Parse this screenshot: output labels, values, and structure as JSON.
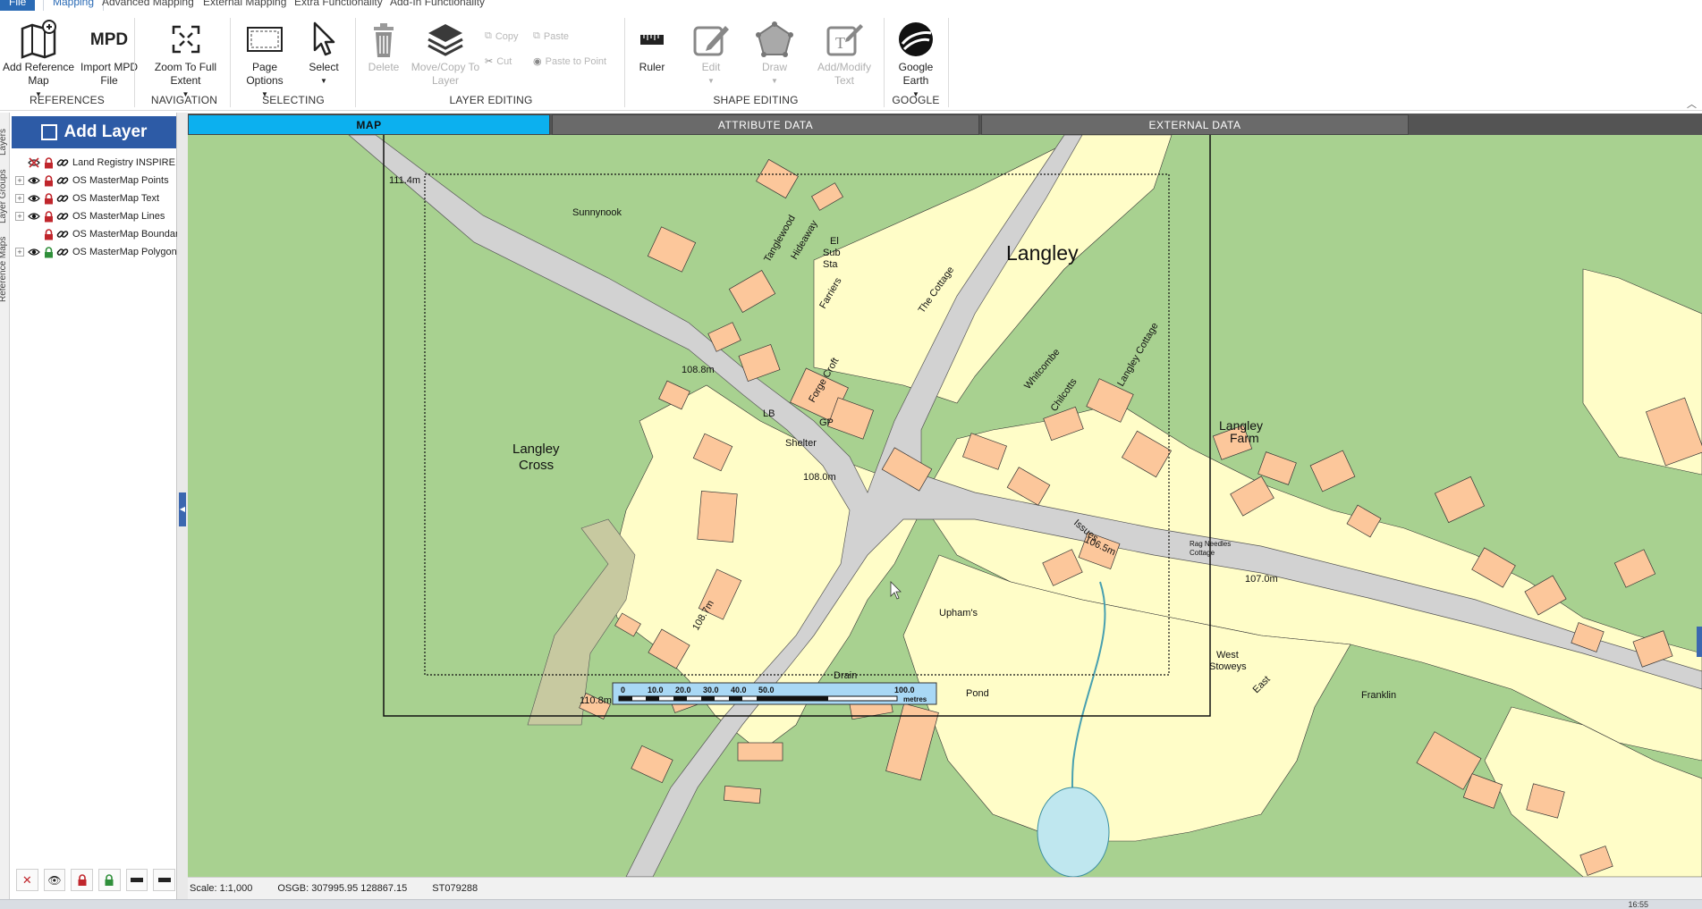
{
  "menu": {
    "tabs": [
      "File",
      "Mapping",
      "Advanced Mapping",
      "External Mapping",
      "Extra Functionality",
      "Add-In Functionality"
    ],
    "active": "Mapping"
  },
  "ribbon": {
    "references": {
      "label": "REFERENCES",
      "add_reference_map": "Add Reference Map",
      "import_mpd": "Import MPD File",
      "mpd_icon_text": "MPD"
    },
    "navigation": {
      "label": "NAVIGATION",
      "zoom_full_extent": "Zoom To Full Extent"
    },
    "selecting": {
      "label": "SELECTING",
      "page_options": "Page Options",
      "select": "Select"
    },
    "layer_editing": {
      "label": "LAYER EDITING",
      "delete": "Delete",
      "move_copy": "Move/Copy To Layer",
      "copy": "Copy",
      "paste": "Paste",
      "cut": "Cut",
      "paste_to_point": "Paste to Point"
    },
    "shape_editing": {
      "label": "SHAPE EDITING",
      "ruler": "Ruler",
      "edit": "Edit",
      "draw": "Draw",
      "add_modify_text": "Add/Modify Text"
    },
    "google": {
      "label": "GOOGLE",
      "google_earth": "Google Earth"
    }
  },
  "left_panel": {
    "vertical_tabs": [
      "Layers",
      "Layer Groups",
      "Reference Maps"
    ],
    "add_layer": "Add Layer",
    "layers": [
      {
        "name": "Land Registry INSPIRE",
        "visible": false,
        "locked": true,
        "expandable": false
      },
      {
        "name": "OS MasterMap Points",
        "visible": true,
        "locked": true,
        "expandable": true
      },
      {
        "name": "OS MasterMap Text",
        "visible": true,
        "locked": true,
        "expandable": true
      },
      {
        "name": "OS MasterMap Lines",
        "visible": true,
        "locked": true,
        "expandable": true
      },
      {
        "name": "OS MasterMap Boundary",
        "visible": false,
        "locked": true,
        "expandable": false
      },
      {
        "name": "OS MasterMap Polygons",
        "visible": true,
        "locked": false,
        "expandable": true
      }
    ]
  },
  "map_tabs": [
    "MAP",
    "ATTRIBUTE DATA",
    "EXTERNAL DATA"
  ],
  "map_labels": {
    "langley": "Langley",
    "langley_cross_1": "Langley",
    "langley_cross_2": "Cross",
    "langley_farm_1": "Langley",
    "langley_farm_2": "Farm",
    "sunnynook": "Sunnynook",
    "tanglewood": "Tanglewood",
    "hideaway": "Hideaway",
    "el": "El",
    "sub": "Sub",
    "sta": "Sta",
    "farriers": "Farriers",
    "the_cottage": "The Cottage",
    "whitcombe": "Whitcombe",
    "chilcotts": "Chilcotts",
    "langley_cottage": "Langley Cottage",
    "forge_croft": "Forge Croft",
    "lb": "LB",
    "gp": "GP",
    "shelter": "Shelter",
    "issues": "Issues",
    "uphams": "Upham's",
    "rag_needles_1": "Rag Needles",
    "rag_needles_2": "Cottage",
    "west_stoweys_1": "West",
    "west_stoweys_2": "Stoweys",
    "east": "East",
    "franklin": "Franklin",
    "drain": "Drain",
    "pond": "Pond",
    "h1114": "111.4m",
    "h1088": "108.8m",
    "h1080": "108.0m",
    "h1065": "106.5m",
    "h1070": "107.0m",
    "h1087": "108.7m",
    "h1108": "110.8m"
  },
  "scale_bar": {
    "ticks": [
      "0",
      "10.0",
      "20.0",
      "30.0",
      "40.0",
      "50.0",
      "100.0"
    ],
    "unit": "metres"
  },
  "status": {
    "scale": "Scale: 1:1,000",
    "osgb": "OSGB: 307995.95  128867.15",
    "grid_ref": "ST079288"
  },
  "taskbar": {
    "clock": "16:55"
  },
  "colors": {
    "accent_blue": "#2d5ba6",
    "map_tab_active": "#0cb0ef",
    "grass": "#a8d190",
    "garden": "#fffdc8",
    "building": "#fcc79b",
    "road": "#d2d2d2",
    "track": "#c7c9a0",
    "lock_red": "#c0262c",
    "lock_green": "#2f8f3a"
  }
}
